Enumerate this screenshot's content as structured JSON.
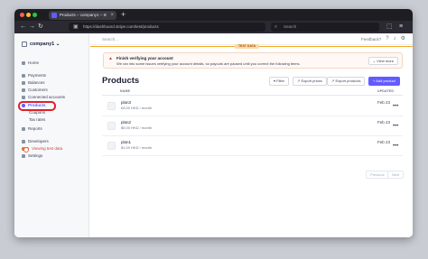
{
  "browser": {
    "tab_title": "Products – company1 – Stripe",
    "tab_close": "×",
    "new_tab": "+",
    "url": "https://dashboard.stripe.com/test/products",
    "search_placeholder": "Search",
    "nav_icons": [
      "back-icon",
      "forward-icon",
      "reload-icon"
    ]
  },
  "sidebar": {
    "account": "company1 ⌄",
    "items": [
      {
        "label": "Home"
      },
      {
        "label": "Payments"
      },
      {
        "label": "Balances"
      },
      {
        "label": "Customers"
      },
      {
        "label": "Connected accounts"
      },
      {
        "label": "Products"
      },
      {
        "label": "Coupons"
      },
      {
        "label": "Tax rates"
      },
      {
        "label": "Reports"
      },
      {
        "label": "Developers"
      },
      {
        "label": "Viewing test data"
      },
      {
        "label": "Settings"
      }
    ]
  },
  "topbar": {
    "search_placeholder": "Search...",
    "feedback": "Feedback?"
  },
  "test_tag": "TEST DATA",
  "banner": {
    "title": "Finish verifying your account",
    "text": "We ran into some issues verifying your account details, so payouts are paused until you correct the following items.",
    "button": "⌄ View more"
  },
  "page": {
    "title": "Products",
    "filter_button": "Filter",
    "export_prices_button": "Export prices",
    "export_products_button": "Export products",
    "add_product_button": "+ Add product"
  },
  "table": {
    "headers": {
      "name": "NAME",
      "updated": "UPDATED"
    },
    "rows": [
      {
        "name": "plan3",
        "price": "£8.00 HKD / month",
        "updated": "Feb 23"
      },
      {
        "name": "plan2",
        "price": "$5.00 HKD / month",
        "updated": "Feb 23"
      },
      {
        "name": "plan1",
        "price": "$1.00 HKD / month",
        "updated": "Feb 23"
      }
    ]
  },
  "pagination": {
    "previous": "Previous",
    "next": "Next"
  },
  "colors": {
    "accent": "#635bff",
    "test_mode": "#f5a623",
    "alert": "#d14343"
  }
}
